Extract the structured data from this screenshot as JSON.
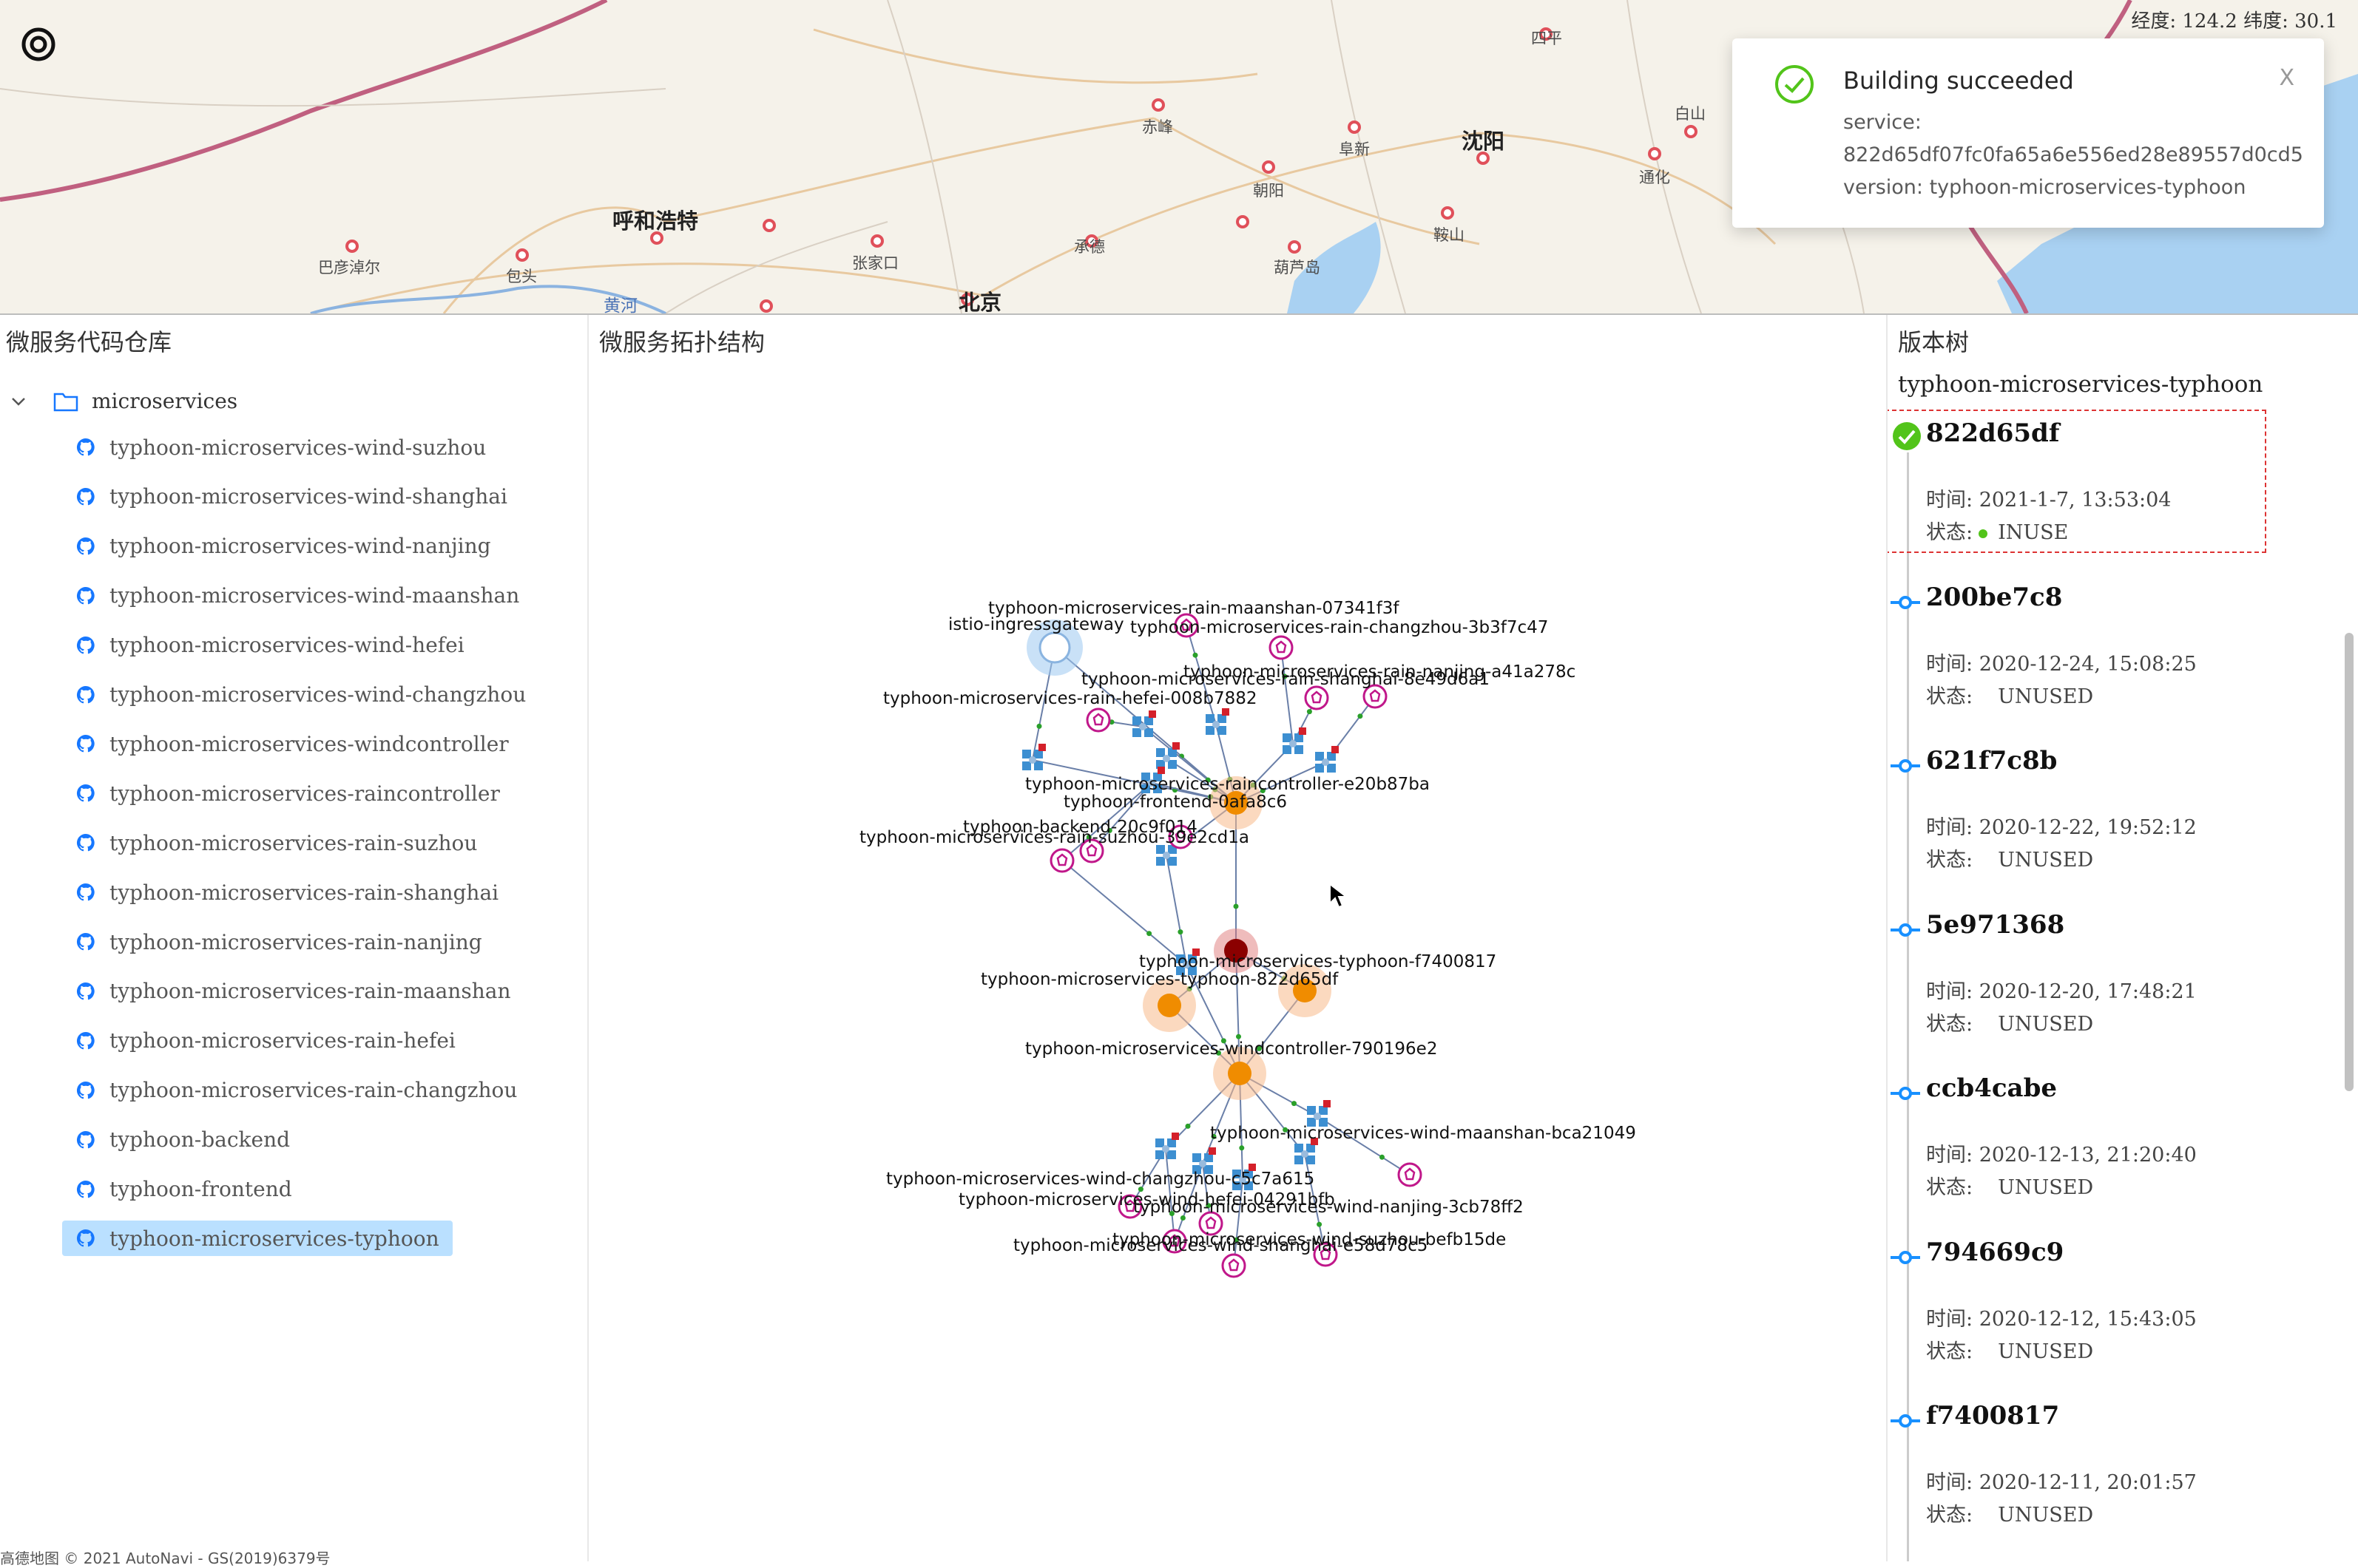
{
  "map": {
    "coords_text": "经度: 124.2 纬度: 30.1",
    "cities": [
      {
        "name": "呼和浩特",
        "big": true
      },
      {
        "name": "北京",
        "big": true
      },
      {
        "name": "沈阳",
        "big": true
      },
      {
        "name": "巴彦淖尔",
        "big": false
      },
      {
        "name": "包头",
        "big": false
      },
      {
        "name": "张家口",
        "big": false
      },
      {
        "name": "承德",
        "big": false
      },
      {
        "name": "赤峰",
        "big": false
      },
      {
        "name": "朝阳",
        "big": false
      },
      {
        "name": "阜新",
        "big": false
      },
      {
        "name": "葫芦岛",
        "big": false
      },
      {
        "name": "鞍山",
        "big": false
      },
      {
        "name": "通化",
        "big": false
      },
      {
        "name": "白山",
        "big": false
      },
      {
        "name": "四平",
        "big": false
      },
      {
        "name": "黄河",
        "big": false
      }
    ],
    "attribution": "高德地图 © 2021 AutoNavi - GS(2019)6379号"
  },
  "notification": {
    "title": "Building succeeded",
    "service_label": "service:",
    "service_value": "822d65df07fc0fa65a6e556ed28e89557d0cd5",
    "version_text": "version: typhoon-microservices-typhoon",
    "close_label": "X"
  },
  "left_panel": {
    "title": "微服务代码仓库",
    "root_folder": "microservices",
    "repos": [
      "typhoon-microservices-wind-suzhou",
      "typhoon-microservices-wind-shanghai",
      "typhoon-microservices-wind-nanjing",
      "typhoon-microservices-wind-maanshan",
      "typhoon-microservices-wind-hefei",
      "typhoon-microservices-wind-changzhou",
      "typhoon-microservices-windcontroller",
      "typhoon-microservices-raincontroller",
      "typhoon-microservices-rain-suzhou",
      "typhoon-microservices-rain-shanghai",
      "typhoon-microservices-rain-nanjing",
      "typhoon-microservices-rain-maanshan",
      "typhoon-microservices-rain-hefei",
      "typhoon-microservices-rain-changzhou",
      "typhoon-backend",
      "typhoon-frontend",
      "typhoon-microservices-typhoon"
    ],
    "selected_repo": "typhoon-microservices-typhoon"
  },
  "middle_panel": {
    "title": "微服务拓扑结构",
    "graph_labels": {
      "gateway": "istio-ingressgateway",
      "rain_maanshan": "typhoon-microservices-rain-maanshan-07341f3f",
      "rain_changzhou": "typhoon-microservices-rain-changzhou-3b3f7c47",
      "rain_nanjing": "typhoon-microservices-rain-nanjing-a41a278c",
      "rain_shanghai": "typhoon-microservices-rain-shanghai-8e49d6a1",
      "rain_hefei": "typhoon-microservices-rain-hefei-008b7882",
      "raincontroller": "typhoon-microservices-raincontroller-e20b87ba",
      "frontend": "typhoon-frontend-0afa8c6",
      "backend": "typhoon-backend-20c9f014",
      "rain_suzhou": "typhoon-microservices-rain-suzhou-39e2cd1a",
      "typhoon_f74": "typhoon-microservices-typhoon-f7400817",
      "typhoon_822": "typhoon-microservices-typhoon-822d65df",
      "windcontroller": "typhoon-microservices-windcontroller-790196e2",
      "wind_maanshan": "typhoon-microservices-wind-maanshan-bca21049",
      "wind_changzhou": "typhoon-microservices-wind-changzhou-c5c7a615",
      "wind_hefei": "typhoon-microservices-wind-hefei-04291bfb",
      "wind_nanjing": "typhoon-microservices-wind-nanjing-3cb78ff2",
      "wind_suzhou": "typhoon-microservices-wind-suzhou-befb15de",
      "wind_shanghai": "typhoon-microservices-wind-shanghai-e58d78c5"
    }
  },
  "right_panel": {
    "title": "版本树",
    "service_name": "typhoon-microservices-typhoon",
    "time_label": "时间:",
    "state_label": "状态:",
    "versions": [
      {
        "hash": "822d65df",
        "time": "2021-1-7, 13:53:04",
        "state": "INUSE",
        "current": true
      },
      {
        "hash": "200be7c8",
        "time": "2020-12-24, 15:08:25",
        "state": "UNUSED",
        "current": false
      },
      {
        "hash": "621f7c8b",
        "time": "2020-12-22, 19:52:12",
        "state": "UNUSED",
        "current": false
      },
      {
        "hash": "5e971368",
        "time": "2020-12-20, 17:48:21",
        "state": "UNUSED",
        "current": false
      },
      {
        "hash": "ccb4cabe",
        "time": "2020-12-13, 21:20:40",
        "state": "UNUSED",
        "current": false
      },
      {
        "hash": "794669c9",
        "time": "2020-12-12, 15:43:05",
        "state": "UNUSED",
        "current": false
      },
      {
        "hash": "f7400817",
        "time": "2020-12-11, 20:01:57",
        "state": "UNUSED",
        "current": false
      }
    ]
  },
  "colors": {
    "success": "#52c41a",
    "selected_bg": "#bae0ff",
    "node_orange": "#f08c00",
    "node_darkred": "#8b0000",
    "pod_magenta": "#c0178a",
    "service_blue": "#3d8fd1",
    "edge": "#6a7fa8"
  }
}
